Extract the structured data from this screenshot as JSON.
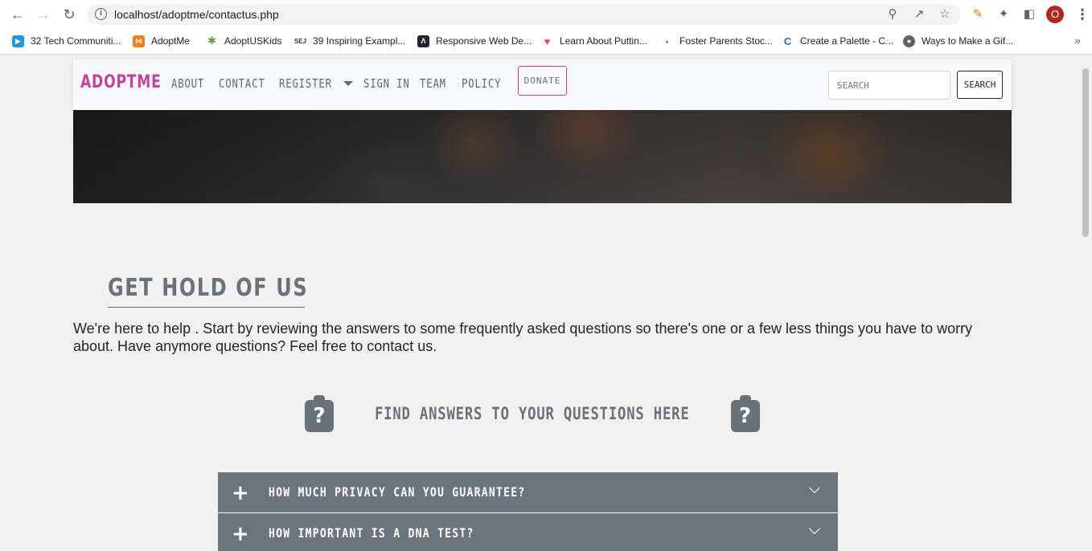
{
  "browser": {
    "url": "localhost/adoptme/contactus.php",
    "avatar_letter": "O",
    "bookmarks": [
      {
        "label": "32 Tech Communiti...",
        "icon": "tech-community-icon",
        "color": "#1e9bd7"
      },
      {
        "label": "AdoptMe",
        "icon": "xampp-icon",
        "color": "#f57c1f"
      },
      {
        "label": "AdoptUSKids",
        "icon": "adoptuskids-icon",
        "color": "#6a9a3a"
      },
      {
        "label": "39 Inspiring Exampl...",
        "icon": "sej-icon",
        "color": "#333333"
      },
      {
        "label": "Responsive Web De...",
        "icon": "responsive-web-icon",
        "color": "#222233"
      },
      {
        "label": "Learn About Puttin...",
        "icon": "heart-icon",
        "color": "#e0457b"
      },
      {
        "label": "Foster Parents Stoc...",
        "icon": "foster-parents-icon",
        "color": "#e4325a"
      },
      {
        "label": "Create a Palette - C...",
        "icon": "coolors-icon",
        "color": "#1e6bff"
      },
      {
        "label": "Ways to Make a Gif...",
        "icon": "globe-icon",
        "color": "#5f6368"
      }
    ]
  },
  "site": {
    "brand": "ADOPTME",
    "nav": {
      "about": "ABOUT",
      "contact": "CONTACT",
      "register": "REGISTER",
      "signin": "SIGN IN",
      "team": "TEAM",
      "policy": "POLICY",
      "donate": "DONATE"
    },
    "search": {
      "placeholder": "SEARCH",
      "button": "SEARCH"
    },
    "colors": {
      "brand": "#c0439e",
      "accordion": "#6c757d",
      "heading": "#69717a"
    }
  },
  "content": {
    "heading": "GET HOLD OF US",
    "intro": "We're here to help . Start by reviewing the answers to some frequently asked questions so there's one or a few less things you have to worry about. Have anymore questions? Feel free to contact us.",
    "faq_title": "FIND ANSWERS TO YOUR QUESTIONS HERE",
    "faq": [
      {
        "question": "HOW MUCH PRIVACY CAN YOU GUARANTEE?"
      },
      {
        "question": "HOW IMPORTANT IS A DNA TEST?"
      }
    ]
  }
}
